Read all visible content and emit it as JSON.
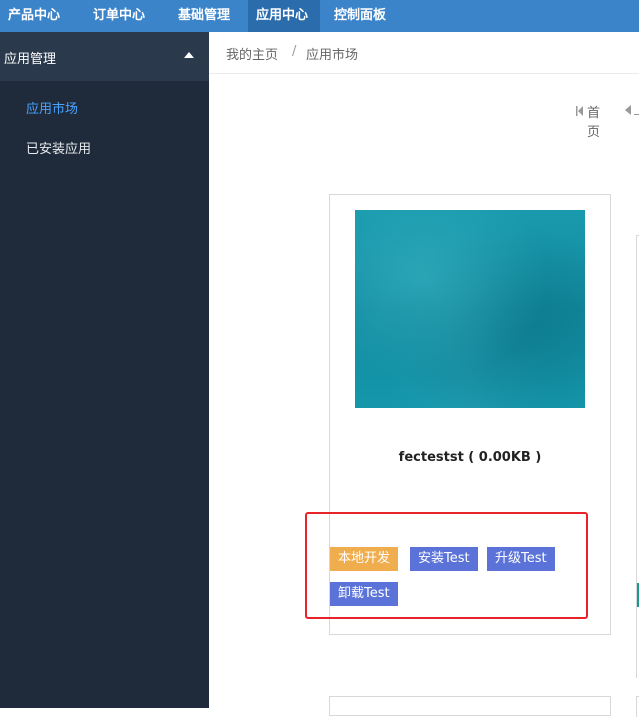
{
  "topnav": {
    "tabs": [
      {
        "label": "产品中心"
      },
      {
        "label": "订单中心"
      },
      {
        "label": "基础管理"
      },
      {
        "label": "应用中心",
        "active": true
      },
      {
        "label": "控制面板"
      }
    ]
  },
  "sidebar": {
    "group_label": "应用管理",
    "items": [
      {
        "label": "应用市场",
        "active": true
      },
      {
        "label": "已安装应用"
      }
    ]
  },
  "breadcrumb": {
    "home": "我的主页",
    "separator": "/",
    "current": "应用市场"
  },
  "pager": {
    "first_label": "首页"
  },
  "app_card": {
    "title": "fectestst ( 0.00KB )",
    "buttons": [
      {
        "label": "本地开发",
        "color": "#f0ad4e"
      },
      {
        "label": "安装Test",
        "color": "#5b73d8"
      },
      {
        "label": "升级Test",
        "color": "#5b73d8"
      },
      {
        "label": "卸载Test",
        "color": "#5b73d8"
      }
    ]
  },
  "colors": {
    "topnav_bg": "#3c84ca",
    "topnav_active": "#2b6cad",
    "sidebar_bg": "#1f2b3a",
    "sidebar_active_text": "#4aa3ff",
    "highlight_border": "#e8242a"
  }
}
